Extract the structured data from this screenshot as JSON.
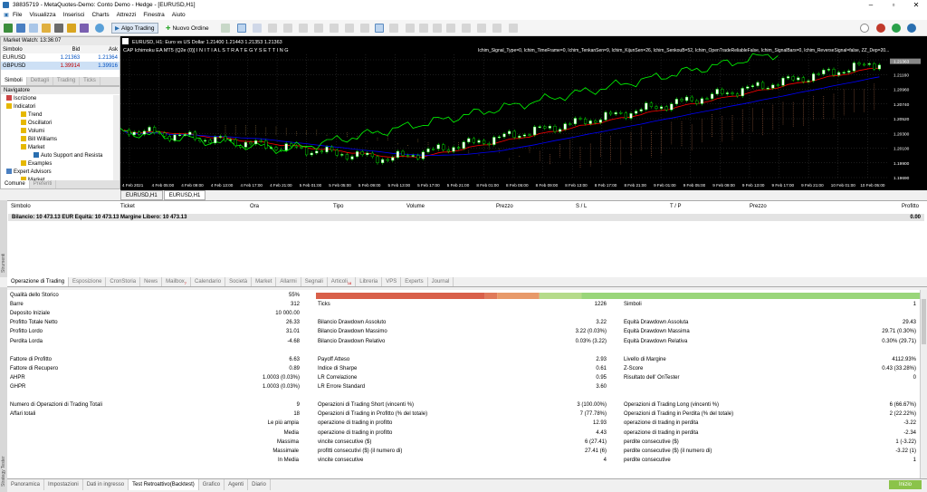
{
  "window": {
    "title": "38835719 - MetaQuotes-Demo: Conto Demo - Hedge - [EURUSD,H1]"
  },
  "menu": [
    "File",
    "Visualizza",
    "Inserisci",
    "Charts",
    "Attrezzi",
    "Finestra",
    "Aiuto"
  ],
  "toolbar": {
    "algo_trading": "Algo Trading",
    "new_order": "Nuovo Ordine"
  },
  "market_watch": {
    "title": "Market Watch: 13:36:07",
    "cols": [
      "Simbolo",
      "Bid",
      "Ask"
    ],
    "rows": [
      {
        "sym": "EURUSD",
        "bid": "1.21363",
        "ask": "1.21364"
      },
      {
        "sym": "GBPUSD",
        "bid": "1.39914",
        "ask": "1.39916"
      }
    ],
    "tabs": [
      "Simboli",
      "Dettagli",
      "Trading",
      "Ticks"
    ]
  },
  "navigator": {
    "title": "Navigatore",
    "items": [
      "Iscrizione",
      "Indicatori",
      "Trend",
      "Oscillatori",
      "Volumi",
      "Bill Williams",
      "Market",
      "Auto Support and Resista",
      "Examples",
      "Expert Advisors",
      "Market"
    ],
    "tabs": [
      "Comune",
      "Preferiti"
    ]
  },
  "chart": {
    "header": "EURUSD, H1:  Euro vs US Dollar  1.21400 1.21443 1.21353 1.21363",
    "ea_label": "CAP Ichimoku EA MT5 (Q2e (0)]  I N I T I A L   S T R A T E G Y   S E T T I N G",
    "params": "Ichim_Signal_Type=0, Ichim_TimeFrame=0, Ichim_TenkanSen=9, Ichim_KijunSen=26, Ichim_SenkouB=52, Ichim_OpenTradeReliableFalse, Ichim_SignalBars=0, Ichim_ReverseSignal=false, ZZ_Dep=20...",
    "prices": [
      "1.21360",
      "1.21160",
      "1.20960",
      "1.20740",
      "1.20520",
      "1.20300",
      "1.20100",
      "1.19900",
      "1.19690"
    ],
    "current_price": "1.21363",
    "times": [
      "4 Feb 2021",
      "4 Feb 05:00",
      "4 Feb 09:00",
      "4 Feb 13:00",
      "4 Feb 17:00",
      "4 Feb 21:00",
      "5 Feb 01:00",
      "5 Feb 05:00",
      "5 Feb 09:00",
      "5 Feb 13:00",
      "5 Feb 17:00",
      "5 Feb 21:00",
      "8 Feb 01:00",
      "8 Feb 05:00",
      "8 Feb 09:00",
      "8 Feb 13:00",
      "8 Feb 17:00",
      "8 Feb 21:00",
      "9 Feb 01:00",
      "9 Feb 05:00",
      "9 Feb 09:00",
      "9 Feb 13:00",
      "9 Feb 17:00",
      "9 Feb 21:00",
      "10 Feb 01:00",
      "10 Feb 05:00"
    ]
  },
  "chart_tabs": [
    "EURUSD,H1",
    "EURUSD,H1"
  ],
  "trade": {
    "cols": [
      "Simbolo",
      "Ticket",
      "Ora",
      "Tipo",
      "Volume",
      "Prezzo",
      "S / L",
      "T / P",
      "Prezzo",
      "Profitto"
    ],
    "balance": "Bilancio: 10 473.13 EUR  Equità: 10 473.13  Margine Libero: 10 473.13",
    "profit": "0.00"
  },
  "side_labels": {
    "toolbox": "Strumenti",
    "tester": "Strategy Tester"
  },
  "toolbox_tabs": [
    "Operazione di Trading",
    "Esposizione",
    "CronStoria",
    "News",
    "Mailbox",
    "Calendario",
    "Società",
    "Market",
    "Allarmi",
    "Segnali",
    "Articoli",
    "Libreria",
    "VPS",
    "Experts",
    "Journal"
  ],
  "toolbox_badges": {
    "mailbox": "7",
    "articoli": "18"
  },
  "report": {
    "col1": [
      [
        "Qualità dello Storico",
        "55%"
      ],
      [
        "Barre",
        "312"
      ],
      [
        "Deposito Iniziale",
        "10 000.00"
      ],
      [
        "Profitto Totale Netto",
        "26.33"
      ],
      [
        "Profitto Lordo",
        "31.01"
      ],
      [
        "Perdita Lorda",
        "-4.68"
      ],
      [
        "",
        ""
      ],
      [
        "Fattore di Profitto",
        "6.63"
      ],
      [
        "Fattore di Recupero",
        "0.89"
      ],
      [
        "AHPR",
        "1.0003 (0.03%)"
      ],
      [
        "GHPR",
        "1.0003 (0.03%)"
      ],
      [
        "",
        ""
      ],
      [
        "Numero di Operazioni di Trading Totali",
        "9"
      ],
      [
        "Affari totali",
        "18"
      ],
      [
        "Le più ampia",
        ""
      ],
      [
        "Media",
        ""
      ],
      [
        "Massima",
        ""
      ],
      [
        "Massimale",
        ""
      ],
      [
        "In Media",
        ""
      ]
    ],
    "col2": [
      [
        "",
        ""
      ],
      [
        "Ticks",
        "1226"
      ],
      [
        "",
        ""
      ],
      [
        "Bilancio Drawdown Assoluto",
        "3.22"
      ],
      [
        "Bilancio Drawdown Massimo",
        "3.22 (0.03%)"
      ],
      [
        "Bilancio Drawdown Relativo",
        "0.03% (3.22)"
      ],
      [
        "",
        ""
      ],
      [
        "Payoff Atteso",
        "2.93"
      ],
      [
        "Indice di Sharpe",
        "0.61"
      ],
      [
        "LR Correlazione",
        "0.95"
      ],
      [
        "LR Errore Standard",
        "3.60"
      ],
      [
        "",
        ""
      ],
      [
        "Operazioni di Trading Short (vincenti %)",
        "3 (100.00%)"
      ],
      [
        "Operazioni di Trading in Profitto (% del totale)",
        "7 (77.78%)"
      ],
      [
        "operazione di trading in profitto",
        "12.93"
      ],
      [
        "operazione di trading in profitto",
        "4.43"
      ],
      [
        "vincite consecutive ($)",
        "6 (27.41)"
      ],
      [
        "profitti consecutivi ($) (il numero di)",
        "27.41 (6)"
      ],
      [
        "vincite consecutive",
        "4"
      ]
    ],
    "col3": [
      [
        "",
        ""
      ],
      [
        "Simboli",
        "1"
      ],
      [
        "",
        ""
      ],
      [
        "Equità Drawdown Assoluta",
        "29.43"
      ],
      [
        "Equità Drawdown Massima",
        "29.71 (0.30%)"
      ],
      [
        "Equità Drawdown Relativa",
        "0.30% (29.71)"
      ],
      [
        "",
        ""
      ],
      [
        "Livello di Margine",
        "4112.93%"
      ],
      [
        "Z-Score",
        "0.43 (33.28%)"
      ],
      [
        "Risultato dell' OnTester",
        "0"
      ],
      [
        "",
        ""
      ],
      [
        "",
        ""
      ],
      [
        "Operazioni di Trading Long (vincenti %)",
        "6 (66.67%)"
      ],
      [
        "Operazioni di Trading in Perdita (% del totale)",
        "2 (22.22%)"
      ],
      [
        "operazione di trading in perdita",
        "-3.22"
      ],
      [
        "operazione di trading in perdita",
        "-2.34"
      ],
      [
        "perdite consecutive ($)",
        "1 (-3.22)"
      ],
      [
        "perdite consecutive ($) (il numero di)",
        "-3.22 (1)"
      ],
      [
        "perdite consecutive",
        "1"
      ]
    ],
    "quality": 0.55
  },
  "tester_tabs": [
    "Panoramica",
    "Impostazioni",
    "Dati in ingresso",
    "Test Retroattivo(Backtest)",
    "Grafico",
    "Agenti",
    "Diario"
  ],
  "start_button": "Inizio",
  "colors": {
    "bull": "#ffffff",
    "bear": "#00ff00",
    "kijun": "#ff0000",
    "tenkan": "#0000ff",
    "chikou": "#00ff00"
  }
}
